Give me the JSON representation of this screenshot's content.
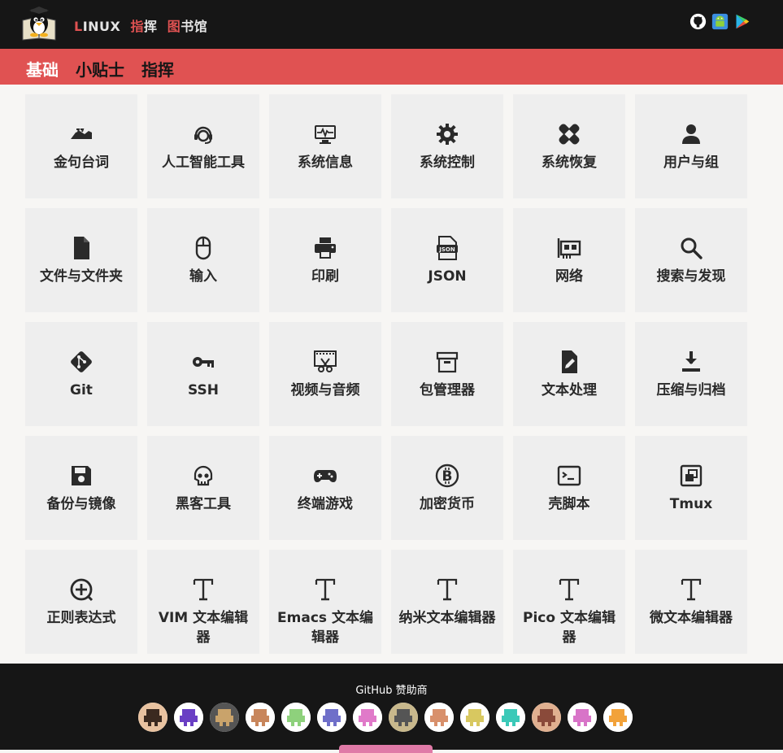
{
  "header": {
    "brand_first_letter": "L",
    "brand_rest": "INUX",
    "brand_zhi": "指",
    "brand_hui": "挥",
    "brand_tu": "图",
    "brand_shuguan": "书馆"
  },
  "nav": {
    "item1": "基础",
    "item2": "小贴士",
    "item3": "指挥"
  },
  "categories": [
    {
      "label": "金句台词",
      "icon": "quote-hands-icon"
    },
    {
      "label": "人工智能工具",
      "icon": "headset-icon"
    },
    {
      "label": "系统信息",
      "icon": "monitor-pulse-icon"
    },
    {
      "label": "系统控制",
      "icon": "gear-icon"
    },
    {
      "label": "系统恢复",
      "icon": "bandage-icon"
    },
    {
      "label": "用户与组",
      "icon": "user-icon"
    },
    {
      "label": "文件与文件夹",
      "icon": "file-icon"
    },
    {
      "label": "输入",
      "icon": "mouse-icon"
    },
    {
      "label": "印刷",
      "icon": "printer-icon"
    },
    {
      "label": "JSON",
      "icon": "json-file-icon"
    },
    {
      "label": "网络",
      "icon": "network-card-icon"
    },
    {
      "label": "搜索与发现",
      "icon": "search-icon"
    },
    {
      "label": "Git",
      "icon": "git-icon"
    },
    {
      "label": "SSH",
      "icon": "key-icon"
    },
    {
      "label": "视频与音频",
      "icon": "film-scissors-icon"
    },
    {
      "label": "包管理器",
      "icon": "archive-box-icon"
    },
    {
      "label": "文本处理",
      "icon": "file-edit-icon"
    },
    {
      "label": "压缩与归档",
      "icon": "download-icon"
    },
    {
      "label": "备份与镜像",
      "icon": "floppy-disk-icon"
    },
    {
      "label": "黑客工具",
      "icon": "skull-icon"
    },
    {
      "label": "终端游戏",
      "icon": "gamepad-icon"
    },
    {
      "label": "加密货币",
      "icon": "bitcoin-icon"
    },
    {
      "label": "壳脚本",
      "icon": "terminal-icon"
    },
    {
      "label": "Tmux",
      "icon": "window-restore-icon"
    },
    {
      "label": "正则表达式",
      "icon": "plus-circle-icon"
    },
    {
      "label": "VIM 文本编辑器",
      "icon": "text-t-icon"
    },
    {
      "label": "Emacs 文本编辑器",
      "icon": "text-t-icon"
    },
    {
      "label": "纳米文本编辑器",
      "icon": "text-t-icon"
    },
    {
      "label": "Pico 文本编辑器",
      "icon": "text-t-icon"
    },
    {
      "label": "微文本编辑器",
      "icon": "text-t-icon"
    }
  ],
  "footer": {
    "sponsors_title": "GitHub 赞助商",
    "sponsor_count": 14
  },
  "colors": {
    "accent": "#e05252",
    "dark": "#161616",
    "card": "#eeeeee",
    "sponsor_button": "#e07aa7"
  }
}
